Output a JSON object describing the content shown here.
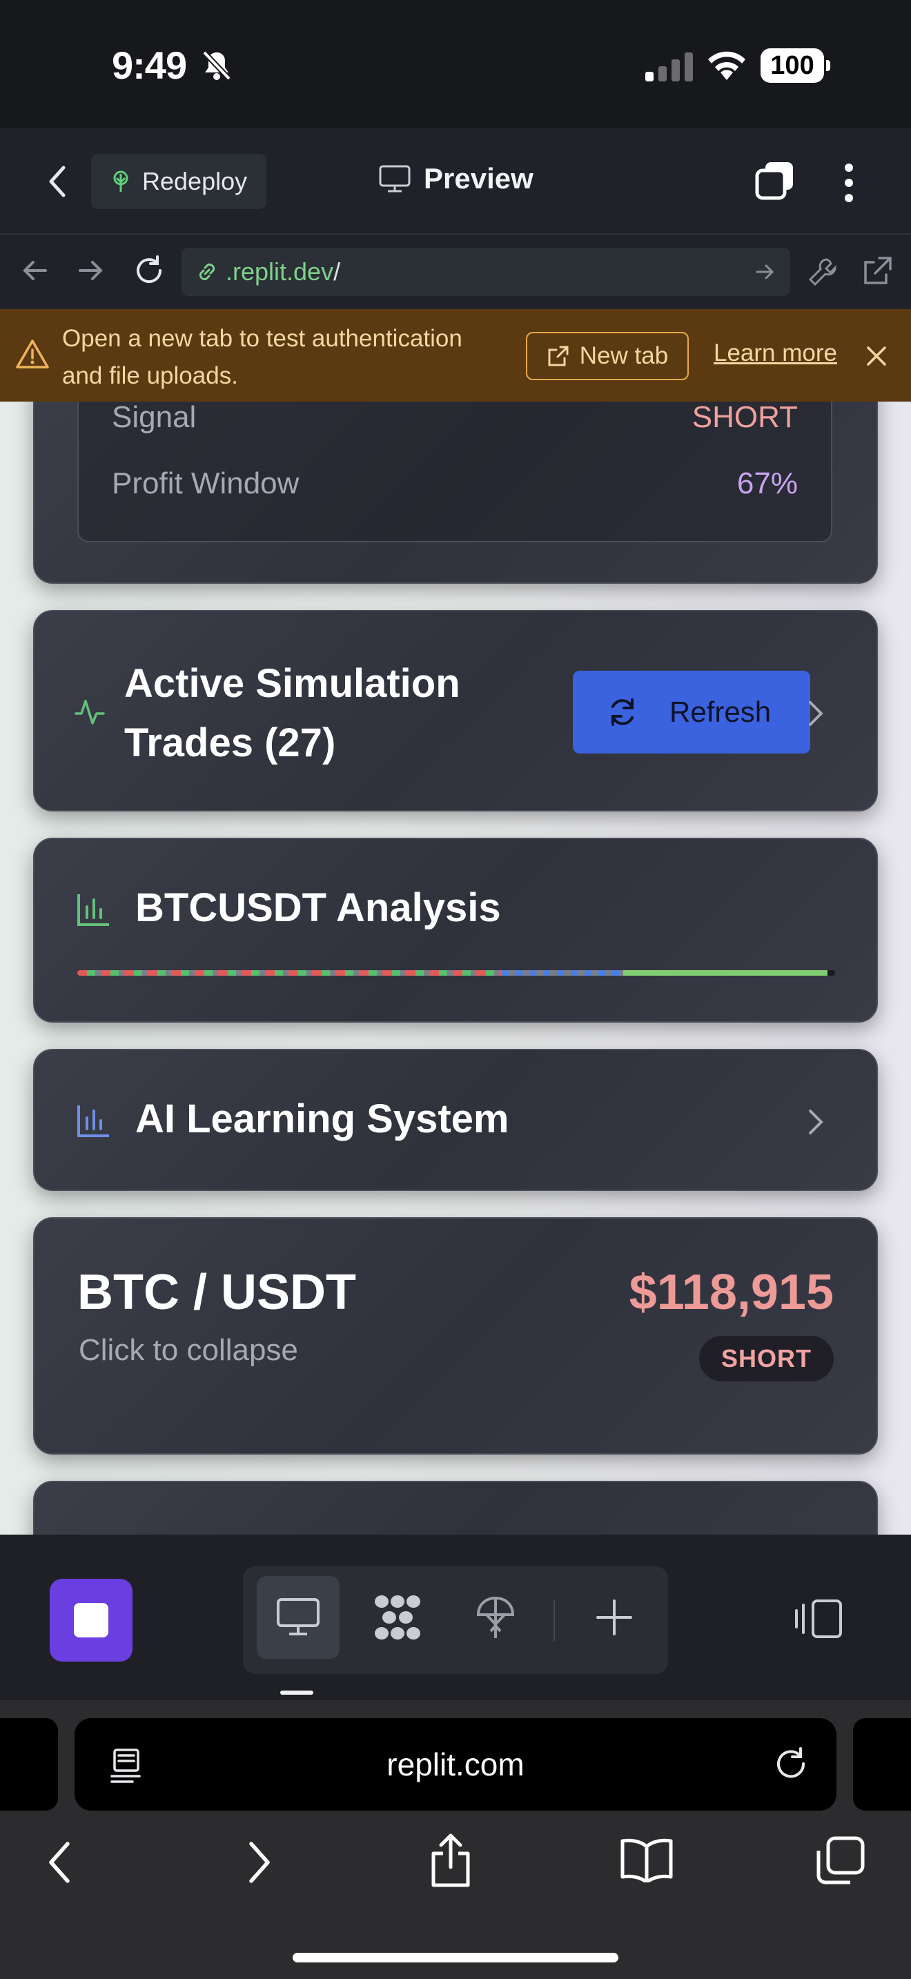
{
  "status_bar": {
    "time": "9:49",
    "battery": "100"
  },
  "header": {
    "redeploy_label": "Redeploy",
    "preview_label": "Preview"
  },
  "url_bar": {
    "host": ".replit.dev",
    "path": "/"
  },
  "banner": {
    "message": "Open a new tab to test authentication and file uploads.",
    "new_tab_label": "New tab",
    "learn_more_label": "Learn more"
  },
  "signal_card": {
    "rows": [
      {
        "label": "Signal",
        "value": "SHORT",
        "color": "#f0a19d"
      },
      {
        "label": "Profit Window",
        "value": "67%",
        "color": "#c7a4f0"
      }
    ]
  },
  "simulation_card": {
    "title": "Active Simulation Trades (27)",
    "refresh_label": "Refresh"
  },
  "analysis_card": {
    "title": "BTCUSDT Analysis",
    "progress": {
      "mixed_fraction": 0.56,
      "blue_fraction": 0.16,
      "green_fraction": 0.27
    }
  },
  "learning_card": {
    "title": "AI Learning System"
  },
  "pair_card": {
    "pair": "BTC / USDT",
    "hint": "Click to collapse",
    "price": "$118,915",
    "signal": "SHORT"
  },
  "safari": {
    "address": "replit.com"
  },
  "colors": {
    "accent_blue": "#3b63e0",
    "stop_purple": "#6a3ee0",
    "banner_bg": "#5b3a12",
    "green_icon": "#63c27a",
    "short_red": "#ee9a96"
  },
  "icons": [
    "chevron-left-icon",
    "sprout-icon",
    "monitor-icon",
    "tabs-icon",
    "kebab-icon",
    "back-arrow-icon",
    "forward-arrow-icon",
    "reload-icon",
    "link-icon",
    "wrench-icon",
    "external-link-icon",
    "warning-icon",
    "close-icon",
    "activity-icon",
    "refresh-icon",
    "bar-chart-icon",
    "chevron-right-icon",
    "workspace-icon",
    "deploy-icon",
    "plus-icon",
    "panel-icon",
    "share-icon",
    "book-icon",
    "tabs-overview-icon"
  ]
}
